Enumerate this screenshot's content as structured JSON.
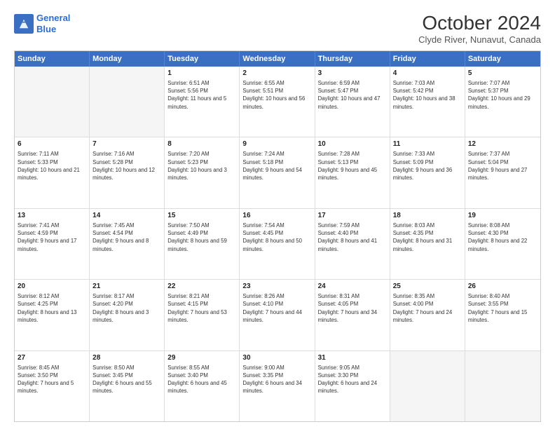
{
  "logo": {
    "line1": "General",
    "line2": "Blue"
  },
  "title": "October 2024",
  "subtitle": "Clyde River, Nunavut, Canada",
  "header_days": [
    "Sunday",
    "Monday",
    "Tuesday",
    "Wednesday",
    "Thursday",
    "Friday",
    "Saturday"
  ],
  "weeks": [
    [
      {
        "day": "",
        "info": "",
        "empty": true
      },
      {
        "day": "",
        "info": "",
        "empty": true
      },
      {
        "day": "1",
        "info": "Sunrise: 6:51 AM\nSunset: 5:56 PM\nDaylight: 11 hours and 5 minutes.",
        "empty": false
      },
      {
        "day": "2",
        "info": "Sunrise: 6:55 AM\nSunset: 5:51 PM\nDaylight: 10 hours and 56 minutes.",
        "empty": false
      },
      {
        "day": "3",
        "info": "Sunrise: 6:59 AM\nSunset: 5:47 PM\nDaylight: 10 hours and 47 minutes.",
        "empty": false
      },
      {
        "day": "4",
        "info": "Sunrise: 7:03 AM\nSunset: 5:42 PM\nDaylight: 10 hours and 38 minutes.",
        "empty": false
      },
      {
        "day": "5",
        "info": "Sunrise: 7:07 AM\nSunset: 5:37 PM\nDaylight: 10 hours and 29 minutes.",
        "empty": false
      }
    ],
    [
      {
        "day": "6",
        "info": "Sunrise: 7:11 AM\nSunset: 5:33 PM\nDaylight: 10 hours and 21 minutes.",
        "empty": false
      },
      {
        "day": "7",
        "info": "Sunrise: 7:16 AM\nSunset: 5:28 PM\nDaylight: 10 hours and 12 minutes.",
        "empty": false
      },
      {
        "day": "8",
        "info": "Sunrise: 7:20 AM\nSunset: 5:23 PM\nDaylight: 10 hours and 3 minutes.",
        "empty": false
      },
      {
        "day": "9",
        "info": "Sunrise: 7:24 AM\nSunset: 5:18 PM\nDaylight: 9 hours and 54 minutes.",
        "empty": false
      },
      {
        "day": "10",
        "info": "Sunrise: 7:28 AM\nSunset: 5:13 PM\nDaylight: 9 hours and 45 minutes.",
        "empty": false
      },
      {
        "day": "11",
        "info": "Sunrise: 7:33 AM\nSunset: 5:09 PM\nDaylight: 9 hours and 36 minutes.",
        "empty": false
      },
      {
        "day": "12",
        "info": "Sunrise: 7:37 AM\nSunset: 5:04 PM\nDaylight: 9 hours and 27 minutes.",
        "empty": false
      }
    ],
    [
      {
        "day": "13",
        "info": "Sunrise: 7:41 AM\nSunset: 4:59 PM\nDaylight: 9 hours and 17 minutes.",
        "empty": false
      },
      {
        "day": "14",
        "info": "Sunrise: 7:45 AM\nSunset: 4:54 PM\nDaylight: 9 hours and 8 minutes.",
        "empty": false
      },
      {
        "day": "15",
        "info": "Sunrise: 7:50 AM\nSunset: 4:49 PM\nDaylight: 8 hours and 59 minutes.",
        "empty": false
      },
      {
        "day": "16",
        "info": "Sunrise: 7:54 AM\nSunset: 4:45 PM\nDaylight: 8 hours and 50 minutes.",
        "empty": false
      },
      {
        "day": "17",
        "info": "Sunrise: 7:59 AM\nSunset: 4:40 PM\nDaylight: 8 hours and 41 minutes.",
        "empty": false
      },
      {
        "day": "18",
        "info": "Sunrise: 8:03 AM\nSunset: 4:35 PM\nDaylight: 8 hours and 31 minutes.",
        "empty": false
      },
      {
        "day": "19",
        "info": "Sunrise: 8:08 AM\nSunset: 4:30 PM\nDaylight: 8 hours and 22 minutes.",
        "empty": false
      }
    ],
    [
      {
        "day": "20",
        "info": "Sunrise: 8:12 AM\nSunset: 4:25 PM\nDaylight: 8 hours and 13 minutes.",
        "empty": false
      },
      {
        "day": "21",
        "info": "Sunrise: 8:17 AM\nSunset: 4:20 PM\nDaylight: 8 hours and 3 minutes.",
        "empty": false
      },
      {
        "day": "22",
        "info": "Sunrise: 8:21 AM\nSunset: 4:15 PM\nDaylight: 7 hours and 53 minutes.",
        "empty": false
      },
      {
        "day": "23",
        "info": "Sunrise: 8:26 AM\nSunset: 4:10 PM\nDaylight: 7 hours and 44 minutes.",
        "empty": false
      },
      {
        "day": "24",
        "info": "Sunrise: 8:31 AM\nSunset: 4:05 PM\nDaylight: 7 hours and 34 minutes.",
        "empty": false
      },
      {
        "day": "25",
        "info": "Sunrise: 8:35 AM\nSunset: 4:00 PM\nDaylight: 7 hours and 24 minutes.",
        "empty": false
      },
      {
        "day": "26",
        "info": "Sunrise: 8:40 AM\nSunset: 3:55 PM\nDaylight: 7 hours and 15 minutes.",
        "empty": false
      }
    ],
    [
      {
        "day": "27",
        "info": "Sunrise: 8:45 AM\nSunset: 3:50 PM\nDaylight: 7 hours and 5 minutes.",
        "empty": false
      },
      {
        "day": "28",
        "info": "Sunrise: 8:50 AM\nSunset: 3:45 PM\nDaylight: 6 hours and 55 minutes.",
        "empty": false
      },
      {
        "day": "29",
        "info": "Sunrise: 8:55 AM\nSunset: 3:40 PM\nDaylight: 6 hours and 45 minutes.",
        "empty": false
      },
      {
        "day": "30",
        "info": "Sunrise: 9:00 AM\nSunset: 3:35 PM\nDaylight: 6 hours and 34 minutes.",
        "empty": false
      },
      {
        "day": "31",
        "info": "Sunrise: 9:05 AM\nSunset: 3:30 PM\nDaylight: 6 hours and 24 minutes.",
        "empty": false
      },
      {
        "day": "",
        "info": "",
        "empty": true
      },
      {
        "day": "",
        "info": "",
        "empty": true
      }
    ]
  ]
}
